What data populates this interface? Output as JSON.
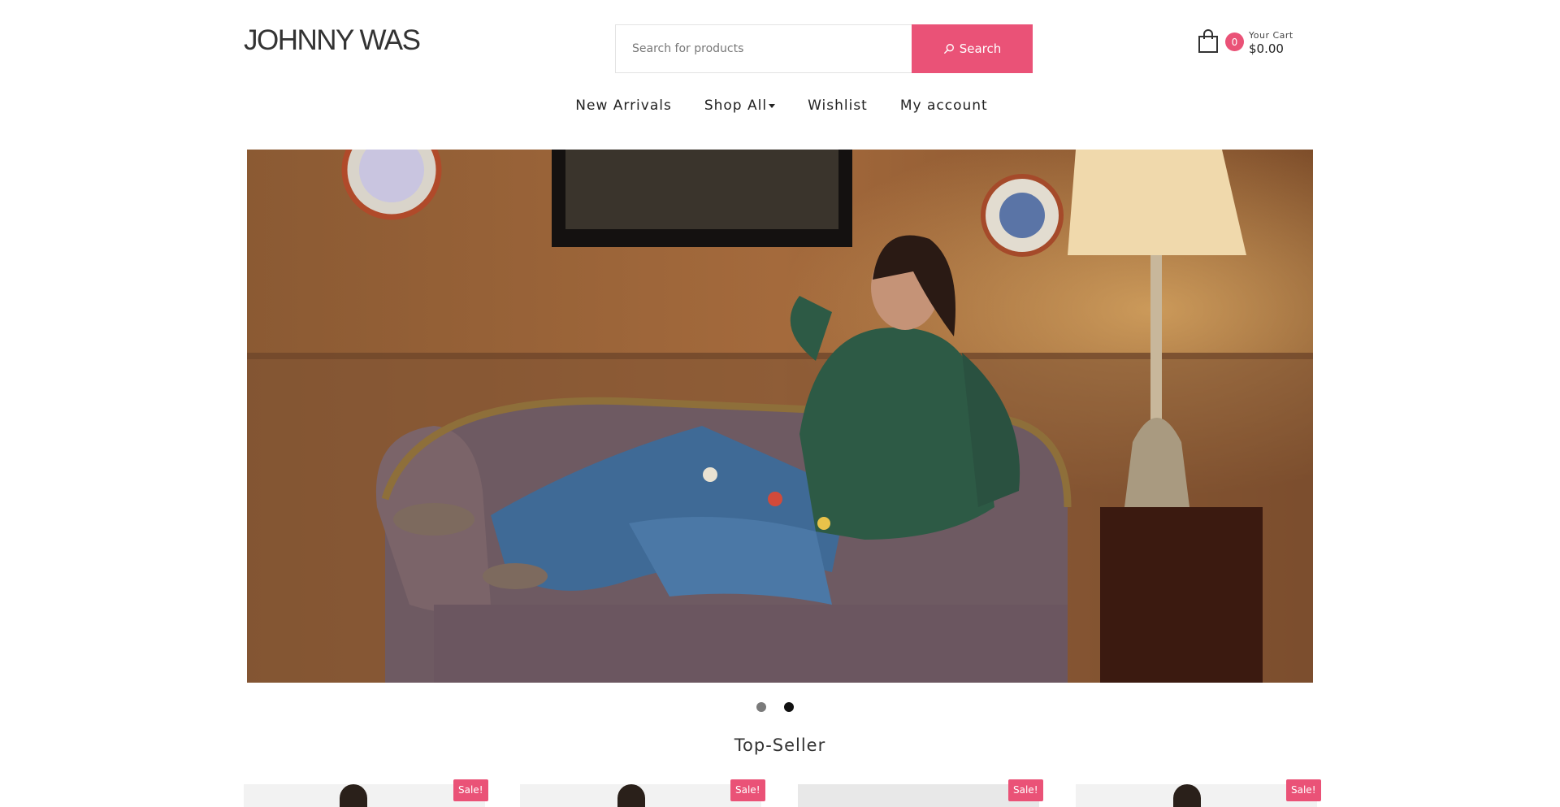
{
  "header": {
    "logo": "JOHNNY WAS",
    "search": {
      "placeholder": "Search for products",
      "button_label": "Search"
    },
    "cart": {
      "count": "0",
      "label": "Your Cart",
      "total": "$0.00"
    }
  },
  "nav": {
    "items": [
      {
        "label": "New Arrivals"
      },
      {
        "label": "Shop All"
      },
      {
        "label": "Wishlist"
      },
      {
        "label": "My account"
      }
    ]
  },
  "hero": {
    "alt": "Model in green velvet blouse and embroidered jeans lounging on a purple sofa",
    "slide_count": 2,
    "active_slide": 2
  },
  "section": {
    "title": "Top-Seller"
  },
  "products": [
    {
      "badge": "Sale!"
    },
    {
      "badge": "Sale!"
    },
    {
      "badge": "Sale!"
    },
    {
      "badge": "Sale!"
    }
  ],
  "colors": {
    "accent": "#ea5277",
    "text": "#222222"
  }
}
